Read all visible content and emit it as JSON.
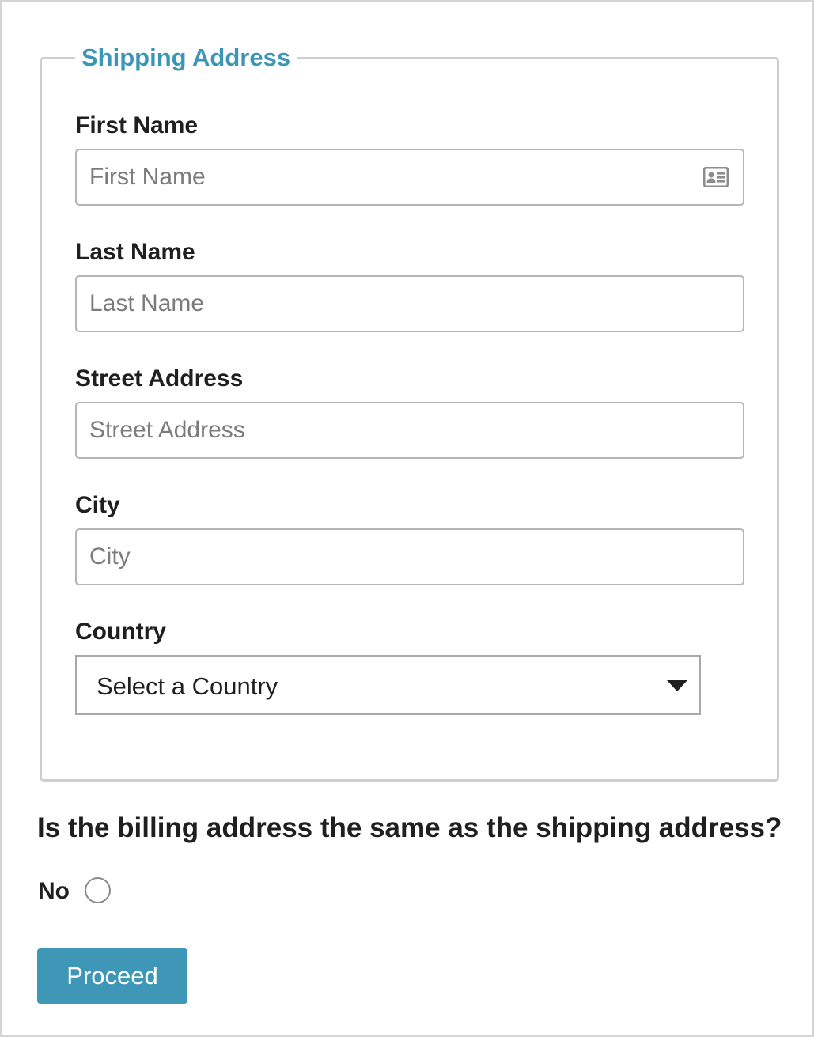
{
  "shipping": {
    "legend": "Shipping Address",
    "fields": [
      {
        "label": "First Name",
        "placeholder": "First Name",
        "value": "",
        "icon": "id-card-icon"
      },
      {
        "label": "Last Name",
        "placeholder": "Last Name",
        "value": ""
      },
      {
        "label": "Street Address",
        "placeholder": "Street Address",
        "value": ""
      },
      {
        "label": "City",
        "placeholder": "City",
        "value": ""
      }
    ],
    "country": {
      "label": "Country",
      "selected": "Select a Country",
      "icon": "caret-down-icon"
    }
  },
  "billing": {
    "question": "Is the billing address the same as the shipping address?",
    "option_no": "No"
  },
  "actions": {
    "proceed_label": "Proceed"
  },
  "colors": {
    "accent": "#3e97b7",
    "legend": "#3b96b6",
    "border": "#cfcfcf"
  }
}
